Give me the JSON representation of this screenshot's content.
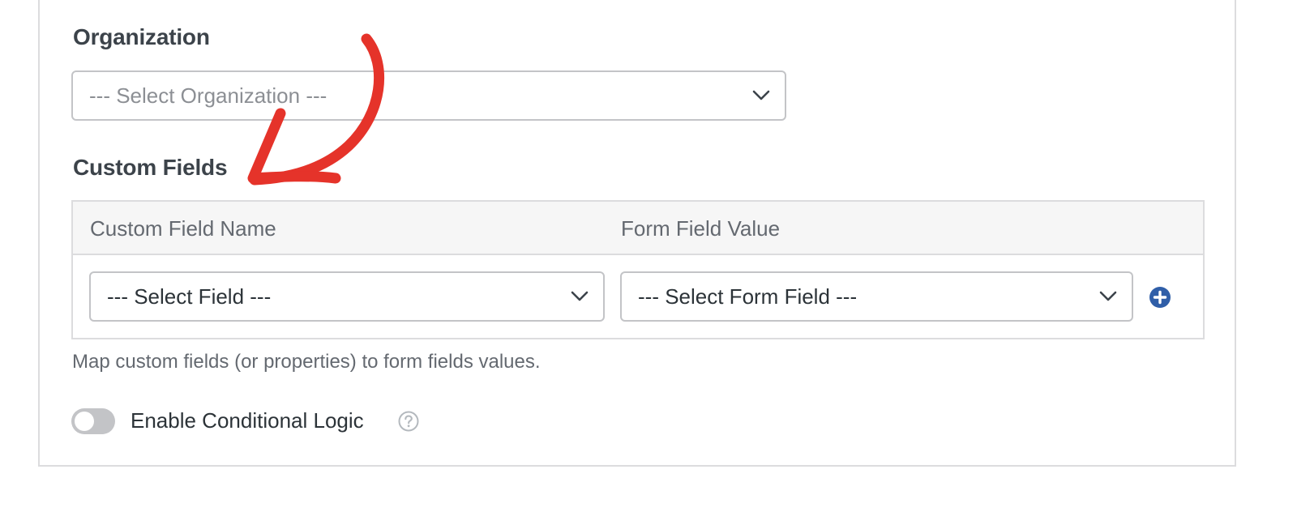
{
  "organization": {
    "heading": "Organization",
    "select_placeholder": "--- Select Organization ---"
  },
  "custom_fields": {
    "heading": "Custom Fields",
    "columns": [
      "Custom Field Name",
      "Form Field Value"
    ],
    "row": {
      "field_select": "--- Select Field ---",
      "form_field_select": "--- Select Form Field ---"
    },
    "help_text": "Map custom fields (or properties) to form fields values."
  },
  "conditional_logic": {
    "label": "Enable Conditional Logic",
    "enabled": false
  },
  "icons": {
    "add": "plus-circle-icon",
    "help": "question-circle-icon",
    "dropdown": "chevron-down-icon",
    "annotation": "red-arrow-annotation"
  },
  "colors": {
    "accent": "#2f5ea8",
    "annotation": "#e5332a",
    "toggle_off": "#c3c4c7"
  }
}
